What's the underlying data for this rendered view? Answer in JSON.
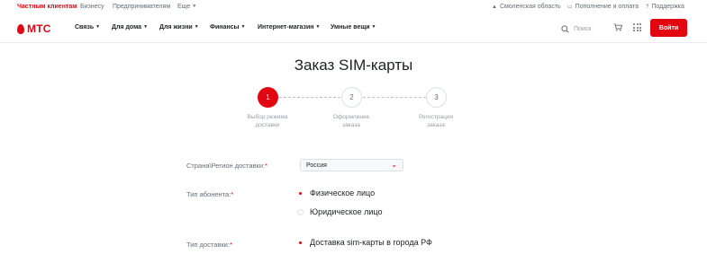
{
  "topbar": {
    "tabs": [
      "Частным клиентам",
      "Бизнесу",
      "Предпринимателям",
      "Еще"
    ],
    "region": "Смоленская область",
    "payment": "Пополнение и оплата",
    "support": "Поддержка"
  },
  "nav": {
    "logo": "МТС",
    "menu": [
      "Связь",
      "Для дома",
      "Для жизни",
      "Финансы",
      "Интернет-магазин",
      "Умные вещи"
    ],
    "search_placeholder": "Поиск",
    "login": "Войти"
  },
  "page": {
    "title": "Заказ SIM-карты",
    "steps": [
      {
        "num": "1",
        "label_1": "Выбор режима",
        "label_2": "доставки"
      },
      {
        "num": "2",
        "label_1": "Оформление",
        "label_2": "заказа"
      },
      {
        "num": "3",
        "label_1": "Регистрация",
        "label_2": "заказа"
      }
    ]
  },
  "form": {
    "country": {
      "label": "Страна\\Регион доставки:",
      "required": "*",
      "value": "Россия"
    },
    "subscriber": {
      "label": "Тип абонента:",
      "required": "*",
      "options": [
        "Физическое лицо",
        "Юридическое лицо"
      ],
      "selected": "Физическое лицо"
    },
    "delivery": {
      "label": "Тип доставки:",
      "required": "*",
      "options": [
        "Доставка sim-карты в города РФ"
      ]
    }
  },
  "colors": {
    "brand": "#e30611",
    "text": "#1d2023",
    "muted": "#626c77",
    "border": "#dde1e7"
  }
}
